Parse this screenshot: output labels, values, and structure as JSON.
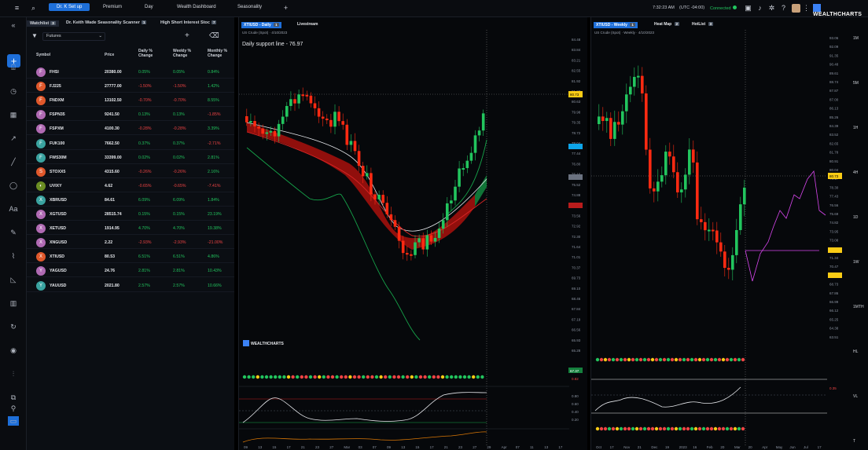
{
  "topbar": {
    "tabs": [
      "Dr. K Set up",
      "Premium",
      "Day",
      "Wealth Dashboard",
      "Seasonality"
    ],
    "time": "7:32:23 AM",
    "timezone": "(UTC -04:00)",
    "connection": "Connected",
    "logo": "WEALTHCHARTS"
  },
  "watchlist": {
    "tabs": [
      "Watchlist",
      "Dr. Keith Wade Seasonality Scanner",
      "High Short Interest Stoc"
    ],
    "tab_badges": [
      "3",
      "1",
      "7"
    ],
    "folder": "Futures",
    "columns": [
      "Symbol",
      "Price",
      "Daily % Change",
      "Weekly % Change",
      "Monthly % Change"
    ],
    "rows": [
      {
        "icon": "F",
        "color": "#b06ab3",
        "symbol": "FHSI",
        "price": "20380.00",
        "d": "0.05%",
        "w": "0.05%",
        "m": "0.84%",
        "ds": "pos",
        "ws": "pos",
        "ms": "pos"
      },
      {
        "icon": "F",
        "color": "#e0582b",
        "symbol": "FJ225",
        "price": "27777.00",
        "d": "-1.50%",
        "w": "-1.50%",
        "m": "1.42%",
        "ds": "neg",
        "ws": "neg",
        "ms": "pos"
      },
      {
        "icon": "F",
        "color": "#e0582b",
        "symbol": "FNDXM",
        "price": "13102.50",
        "d": "-0.70%",
        "w": "-0.70%",
        "m": "8.55%",
        "ds": "neg",
        "ws": "neg",
        "ms": "pos"
      },
      {
        "icon": "F",
        "color": "#b06ab3",
        "symbol": "FSPN35",
        "price": "9241.50",
        "d": "0.13%",
        "w": "0.13%",
        "m": "-1.85%",
        "ds": "pos",
        "ws": "pos",
        "ms": "neg"
      },
      {
        "icon": "F",
        "color": "#b06ab3",
        "symbol": "FSPXM",
        "price": "4100.30",
        "d": "-0.28%",
        "w": "-0.28%",
        "m": "3.39%",
        "ds": "neg",
        "ws": "neg",
        "ms": "pos"
      },
      {
        "icon": "F",
        "color": "#3aa3a0",
        "symbol": "FUK100",
        "price": "7662.50",
        "d": "0.37%",
        "w": "0.37%",
        "m": "-2.71%",
        "ds": "pos",
        "ws": "pos",
        "ms": "neg"
      },
      {
        "icon": "F",
        "color": "#3aa3a0",
        "symbol": "FWS30M",
        "price": "33399.00",
        "d": "0.02%",
        "w": "0.02%",
        "m": "2.81%",
        "ds": "pos",
        "ws": "pos",
        "ms": "pos"
      },
      {
        "icon": "S",
        "color": "#e0582b",
        "symbol": "STOXX5",
        "price": "4315.60",
        "d": "-0.26%",
        "w": "-0.26%",
        "m": "2.16%",
        "ds": "neg",
        "ws": "neg",
        "ms": "pos"
      },
      {
        "icon": "◐",
        "color": "#6b8e23",
        "symbol": "UVIXY",
        "price": "4.62",
        "d": "-0.65%",
        "w": "-0.65%",
        "m": "-7.41%",
        "ds": "neg",
        "ws": "neg",
        "ms": "neg"
      },
      {
        "icon": "X",
        "color": "#3aa3a0",
        "symbol": "XBRUSD",
        "price": "84.61",
        "d": "6.09%",
        "w": "6.09%",
        "m": "1.84%",
        "ds": "pos",
        "ws": "pos",
        "ms": "pos"
      },
      {
        "icon": "X",
        "color": "#b06ab3",
        "symbol": "XGTUSD",
        "price": "28515.74",
        "d": "0.15%",
        "w": "0.15%",
        "m": "23.19%",
        "ds": "pos",
        "ws": "pos",
        "ms": "pos"
      },
      {
        "icon": "X",
        "color": "#b06ab3",
        "symbol": "XETUSD",
        "price": "1914.95",
        "d": "4.70%",
        "w": "4.70%",
        "m": "19.38%",
        "ds": "pos",
        "ws": "pos",
        "ms": "pos"
      },
      {
        "icon": "X",
        "color": "#b06ab3",
        "symbol": "XNGUSD",
        "price": "2.22",
        "d": "-2.93%",
        "w": "-2.93%",
        "m": "-21.00%",
        "ds": "neg",
        "ws": "neg",
        "ms": "neg"
      },
      {
        "icon": "X",
        "color": "#e0582b",
        "symbol": "XTIUSD",
        "price": "80.53",
        "d": "6.51%",
        "w": "6.51%",
        "m": "4.86%",
        "ds": "pos",
        "ws": "pos",
        "ms": "pos"
      },
      {
        "icon": "Y",
        "color": "#b06ab3",
        "symbol": "YAGUSD",
        "price": "24.76",
        "d": "2.81%",
        "w": "2.81%",
        "m": "10.43%",
        "ds": "pos",
        "ws": "pos",
        "ms": "pos"
      },
      {
        "icon": "Y",
        "color": "#3aa3a0",
        "symbol": "YAUUSD",
        "price": "2021.80",
        "d": "2.57%",
        "w": "2.57%",
        "m": "10.66%",
        "ds": "pos",
        "ws": "pos",
        "ms": "pos"
      }
    ]
  },
  "left_chart": {
    "tabs": [
      "XTIUSD - Daily",
      "Livestream"
    ],
    "tab_badges": [
      "1",
      ""
    ],
    "subtitle": "US Crude (Spot) · 4/10/2023",
    "annotation": "Daily support line - 76.97",
    "logo": "WEALTHCHARTS",
    "price_labels": [
      "84.48",
      "83.84",
      "83.21",
      "82.55",
      "81.92",
      "81.27",
      "80.63",
      "79.98",
      "79.35",
      "78.72",
      "78.04",
      "77.44",
      "76.80",
      "76.16",
      "75.52",
      "74.88",
      "74.24",
      "73.56",
      "72.92",
      "72.30",
      "71.64",
      "71.01",
      "70.37",
      "69.73",
      "69.10",
      "68.46",
      "67.84",
      "67.19",
      "66.56",
      "65.93",
      "65.28"
    ],
    "x_labels": [
      "09",
      "13",
      "15",
      "17",
      "21",
      "23",
      "27",
      "Mar",
      "03",
      "07",
      "09",
      "13",
      "15",
      "17",
      "21",
      "23",
      "27",
      "29",
      "Apr",
      "07",
      "11",
      "13",
      "17"
    ],
    "last_price": "80.73",
    "osc_labels": [
      "0.80",
      "0.60",
      "0.40",
      "0.20"
    ],
    "osc_badges": [
      "67.37",
      "0.82"
    ]
  },
  "right_chart": {
    "tabs": [
      "XTIUSD - Weekly",
      "Heat Map",
      "HotList"
    ],
    "tab_badges": [
      "1",
      "2",
      "3"
    ],
    "subtitle": "US Crude (Spot) · Weekly · 4/10/2023",
    "price_labels": [
      "93.06",
      "92.09",
      "91.35",
      "90.48",
      "89.61",
      "88.74",
      "87.87",
      "87.00",
      "86.13",
      "85.26",
      "84.39",
      "83.52",
      "82.65",
      "81.78",
      "80.91",
      "80.04",
      "79.17",
      "78.30",
      "77.43",
      "76.56",
      "75.69",
      "74.82",
      "73.95",
      "73.08",
      "72.21",
      "71.34",
      "70.47",
      "69.60",
      "68.73",
      "67.86",
      "66.99",
      "66.12",
      "65.25",
      "64.38",
      "63.51"
    ],
    "x_labels": [
      "Oct",
      "17",
      "Nov",
      "21",
      "Dec",
      "19",
      "2023",
      "16",
      "Feb",
      "20",
      "Mar",
      "20",
      "Apr",
      "May",
      "Jun",
      "Jul",
      "17"
    ],
    "timeframes": [
      "1M",
      "5M",
      "1H",
      "4H",
      "1D",
      "1W",
      "1MTH",
      "HL",
      "VL",
      "T"
    ],
    "last_price": "80.73",
    "osc_badge": "0.35"
  },
  "colors": {
    "up": "#22c55e",
    "down": "#ff2a12",
    "accent": "#1e6fd9",
    "projection": "#d946ef"
  }
}
